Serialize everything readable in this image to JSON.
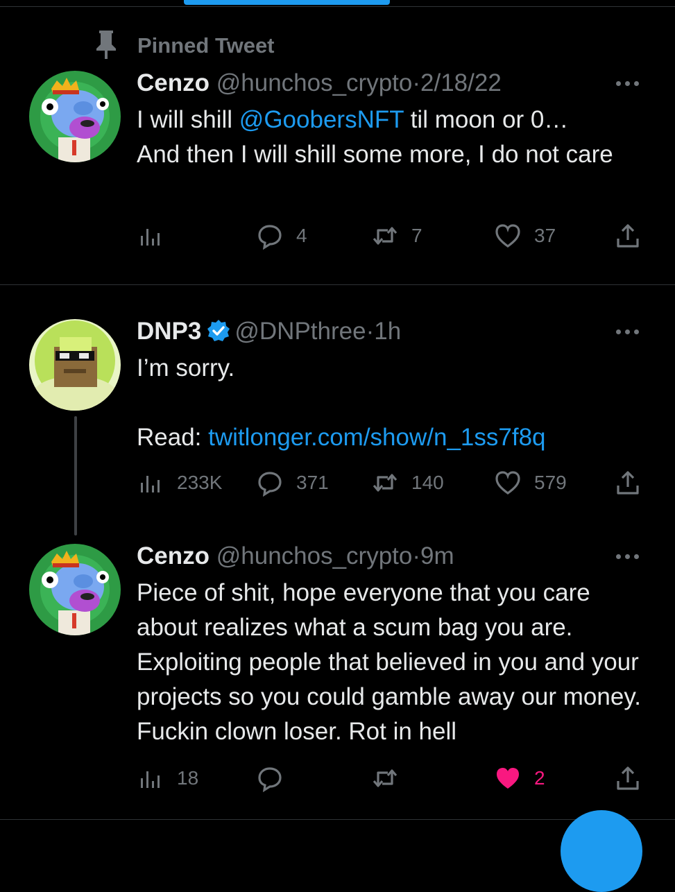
{
  "colors": {
    "background": "#000000",
    "accent": "#1d9bf0",
    "like": "#f91880",
    "muted": "#71767b",
    "text": "#e7e9ea"
  },
  "pinned": {
    "icon": "pin-icon",
    "label": "Pinned Tweet"
  },
  "tweets": [
    {
      "name": "Cenzo",
      "handle": "@hunchos_crypto",
      "separator": "·",
      "time": "2/18/22",
      "verified": false,
      "text": {
        "line1_pre": "I will shill ",
        "mention": "@GoobersNFT",
        "line1_post": " til moon or 0…",
        "rest": "And then I will shill some more, I do not care"
      },
      "actions": {
        "views": "",
        "replies": "4",
        "retweets": "7",
        "likes": "37",
        "liked": false
      }
    },
    {
      "name": "DNP3",
      "handle": "@DNPthree",
      "separator": "·",
      "time": "1h",
      "verified": true,
      "text": {
        "line1": "I’m sorry.",
        "read_label": "Read: ",
        "link": "twitlonger.com/show/n_1ss7f8q"
      },
      "actions": {
        "views": "233K",
        "replies": "371",
        "retweets": "140",
        "likes": "579",
        "liked": false
      }
    },
    {
      "name": "Cenzo",
      "handle": "@hunchos_crypto",
      "separator": "·",
      "time": "9m",
      "verified": false,
      "text": {
        "body": "Piece of shit, hope everyone that you care about realizes what a scum bag you are. Exploiting people that believed in you and your projects so you could gamble away our money. Fuckin clown loser. Rot in hell"
      },
      "actions": {
        "views": "18",
        "replies": "",
        "retweets": "",
        "likes": "2",
        "liked": true
      }
    }
  ]
}
